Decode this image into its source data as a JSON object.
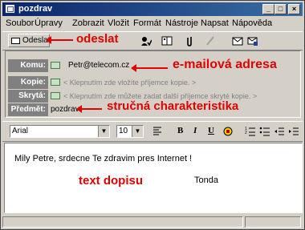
{
  "window": {
    "title": "pozdrav"
  },
  "titlebar_buttons": {
    "minimize": "_",
    "maximize": "□",
    "close": "×"
  },
  "menu": [
    "Soubor",
    "Úpravy",
    "Zobrazit",
    "Vložit",
    "Formát",
    "Nástroje",
    "Napsat",
    "Nápověda"
  ],
  "toolbar": {
    "send_label": "Odeslat"
  },
  "header": {
    "to_label": "Komu:",
    "to_value": "Petr@telecom.cz",
    "cc_label": "Kopie:",
    "cc_placeholder": "< Klepnutím zde vložíte příjemce kopie. >",
    "bcc_label": "Skrytá:",
    "bcc_placeholder": "< Klepnutím zde můžete zadat další příjemce skryté kopie. >",
    "subject_label": "Předmět:",
    "subject_value": "pozdrav"
  },
  "format": {
    "font": "Arial",
    "size": "10",
    "bold": "B",
    "italic": "I",
    "underline": "U"
  },
  "message": {
    "body": "Mily Petre, srdecne Te zdravim pres Internet !",
    "signature": "Tonda"
  },
  "annotations": {
    "send": "odeslat",
    "email": "e-mailová adresa",
    "subject": "stručná charakteristika",
    "body": "text dopisu"
  },
  "colors": {
    "annotation": "#e00000",
    "titlebar": "#0a246a",
    "window": "#d4d0c8"
  }
}
